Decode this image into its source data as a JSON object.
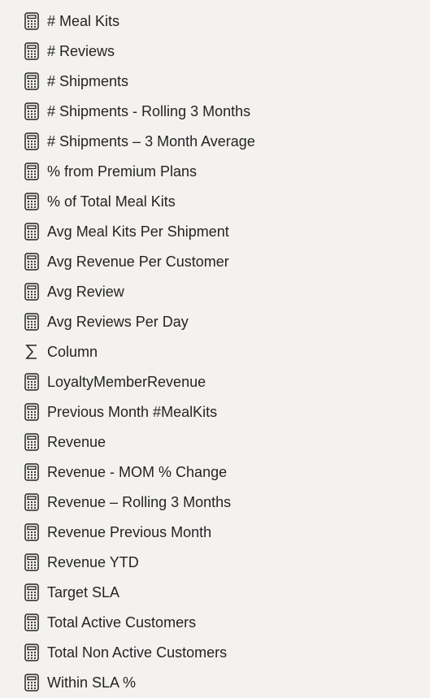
{
  "fields": [
    {
      "label": "# Meal Kits",
      "icon": "calculator-icon"
    },
    {
      "label": "# Reviews",
      "icon": "calculator-icon"
    },
    {
      "label": "# Shipments",
      "icon": "calculator-icon"
    },
    {
      "label": "# Shipments - Rolling 3 Months",
      "icon": "calculator-icon"
    },
    {
      "label": "# Shipments – 3 Month Average",
      "icon": "calculator-icon"
    },
    {
      "label": "% from Premium Plans",
      "icon": "calculator-icon"
    },
    {
      "label": "% of Total Meal Kits",
      "icon": "calculator-icon"
    },
    {
      "label": "Avg Meal Kits Per Shipment",
      "icon": "calculator-icon"
    },
    {
      "label": "Avg Revenue Per Customer",
      "icon": "calculator-icon"
    },
    {
      "label": "Avg Review",
      "icon": "calculator-icon"
    },
    {
      "label": "Avg Reviews Per Day",
      "icon": "calculator-icon"
    },
    {
      "label": "Column",
      "icon": "sigma-icon"
    },
    {
      "label": "LoyaltyMemberRevenue",
      "icon": "calculator-icon"
    },
    {
      "label": "Previous Month #MealKits",
      "icon": "calculator-icon"
    },
    {
      "label": "Revenue",
      "icon": "calculator-icon"
    },
    {
      "label": "Revenue - MOM % Change",
      "icon": "calculator-icon"
    },
    {
      "label": "Revenue – Rolling 3 Months",
      "icon": "calculator-icon"
    },
    {
      "label": "Revenue Previous Month",
      "icon": "calculator-icon"
    },
    {
      "label": "Revenue YTD",
      "icon": "calculator-icon"
    },
    {
      "label": "Target SLA",
      "icon": "calculator-icon"
    },
    {
      "label": "Total Active Customers",
      "icon": "calculator-icon"
    },
    {
      "label": "Total Non Active Customers",
      "icon": "calculator-icon"
    },
    {
      "label": "Within SLA %",
      "icon": "calculator-icon"
    }
  ]
}
